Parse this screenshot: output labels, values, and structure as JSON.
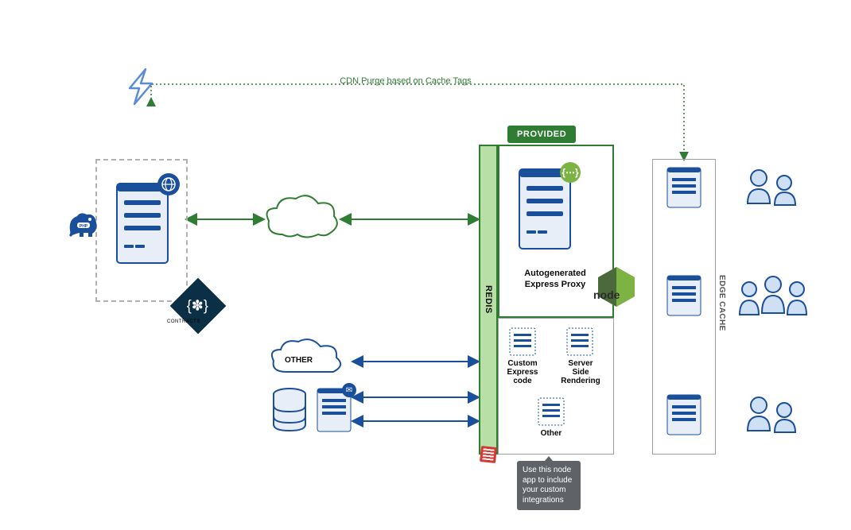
{
  "cdn_purge_label": "CDN Purge based on Cache Tags",
  "provided_badge": "PROVIDED",
  "redis_label": "REDIS",
  "edge_cache_label": "EDGE CACHE",
  "proxy": {
    "label_line1": "Autogenerated",
    "label_line2": "Express Proxy"
  },
  "custom_express": {
    "line1": "Custom",
    "line2": "Express",
    "line3": "code"
  },
  "ssr": {
    "line1": "Server",
    "line2": "Side",
    "line3": "Rendering"
  },
  "other_block": "Other",
  "other_cloud_label": "OTHER",
  "tooltip": "Use this node app to include your custom integrations",
  "swagger_label": "CONTRACTS",
  "nodejs_text": "node"
}
